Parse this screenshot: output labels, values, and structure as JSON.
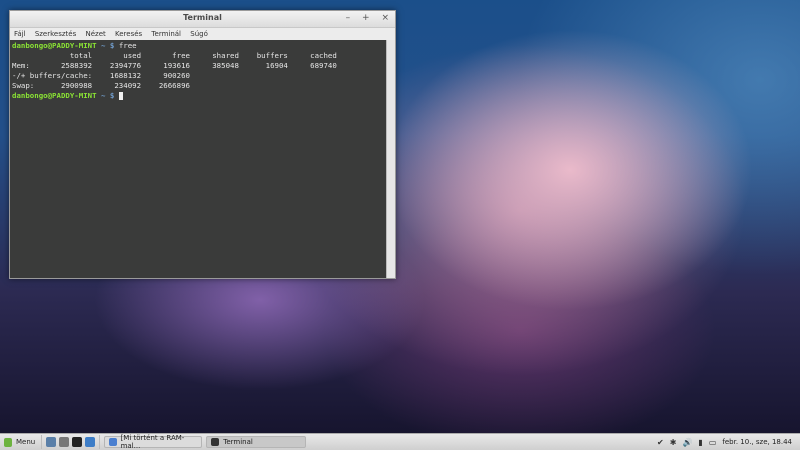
{
  "window": {
    "title": "Terminal",
    "controls": {
      "minimize": "–",
      "maximize": "+",
      "close": "×"
    },
    "menu": [
      "Fájl",
      "Szerkesztés",
      "Nézet",
      "Keresés",
      "Terminál",
      "Súgó"
    ]
  },
  "terminal": {
    "prompt_user": "danbongo@PADDY-MINT",
    "prompt_path": "~ $",
    "command": "free",
    "header": "             total       used       free     shared    buffers     cached",
    "rows": [
      "Mem:       2588392    2394776     193616     385048      16904     689740",
      "-/+ buffers/cache:    1688132     900260",
      "Swap:      2900988     234092    2666896"
    ]
  },
  "panel": {
    "menu_label": "Menu",
    "tasks": [
      {
        "label": "[Mi történt a RAM-mal...",
        "icon_color": "#4a7fd0"
      },
      {
        "label": "Terminal",
        "icon_color": "#333333"
      }
    ],
    "clock": "febr. 10., sze, 18.44"
  },
  "colors": {
    "prompt_user": "#8ae234",
    "prompt_path": "#729fcf",
    "terminal_bg": "#3a3b3a"
  }
}
